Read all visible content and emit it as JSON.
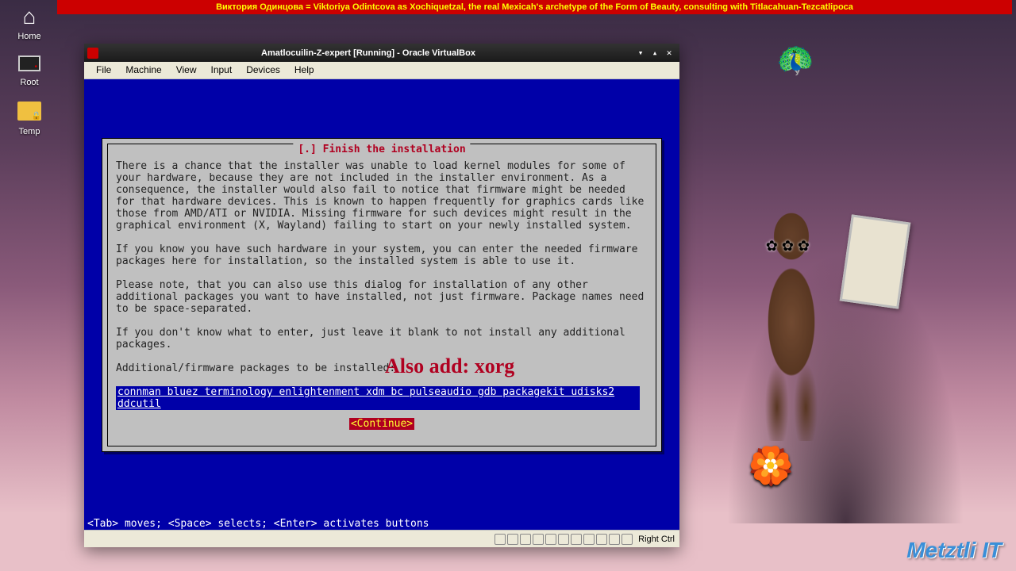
{
  "banner": "Bиктория Одинцова = Viktoriya Odintcova as Xochiquetzal, the real Mexicah's archetype of the Form of Beauty, consulting with Titlacahuan-Tezcatlipoca",
  "desktop": {
    "home": "Home",
    "root": "Root",
    "temp": "Temp"
  },
  "vb": {
    "title": "Amatlocuilin-Z-expert [Running] - Oracle VirtualBox",
    "menu": [
      "File",
      "Machine",
      "View",
      "Input",
      "Devices",
      "Help"
    ],
    "hostkey": "Right Ctrl"
  },
  "installer": {
    "title": "[.] Finish the installation",
    "p1": "There is a chance that the installer was unable to load kernel modules for some of your hardware, because they are not included in the installer environment. As a consequence, the installer would also fail to notice that firmware might be needed for that hardware devices. This is known to happen frequently for graphics cards like those from AMD/ATI or NVIDIA. Missing firmware for such devices might result in the graphical environment (X, Wayland) failing to start on your newly installed system.",
    "p2": "If you know you have such hardware in your system, you can enter the needed firmware packages here for installation, so the installed system is able to use it.",
    "p3": "Please note, that you can also use this dialog for installation of any other additional packages you want to have installed, not just firmware. Package names need to be space-separated.",
    "p4": "If you don't know what to enter, just leave it blank to not install any additional packages.",
    "prompt": "Additional/firmware packages to be installed:",
    "packages": "connman bluez terminology enlightenment xdm bc pulseaudio gdb packagekit udisks2 ddcutil ",
    "continue": "<Continue>",
    "hint": "<Tab> moves; <Space> selects; <Enter> activates buttons"
  },
  "annotation": "Also add: xorg",
  "logo": "Metztli IT"
}
